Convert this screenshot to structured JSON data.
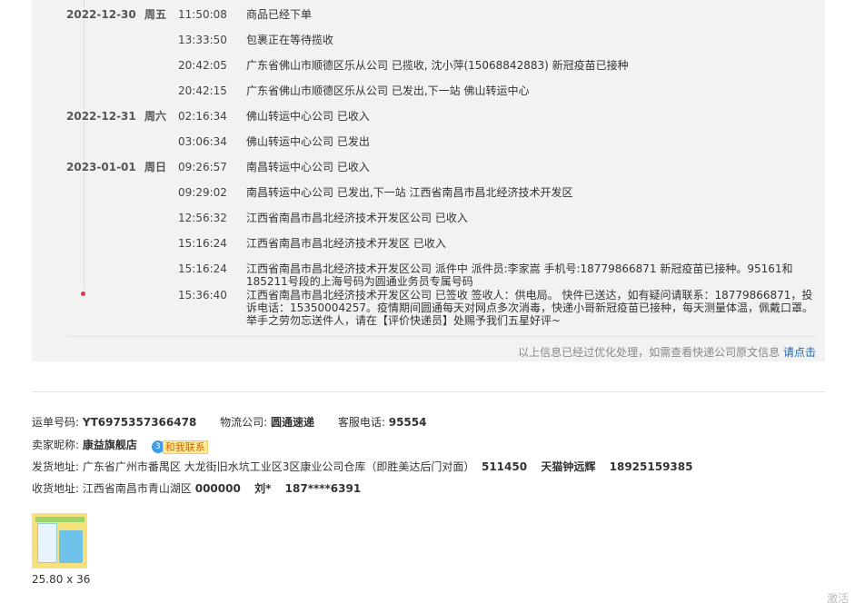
{
  "tracking": [
    {
      "date": "2022-12-30",
      "weekday": "周五",
      "time": "11:50:08",
      "msg": "商品已经下单"
    },
    {
      "date": "",
      "weekday": "",
      "time": "13:33:50",
      "msg": "包裹正在等待揽收"
    },
    {
      "date": "",
      "weekday": "",
      "time": "20:42:05",
      "msg": "广东省佛山市顺德区乐从公司 已揽收, 沈小萍(15068842883) 新冠疫苗已接种"
    },
    {
      "date": "",
      "weekday": "",
      "time": "20:42:15",
      "msg": "广东省佛山市顺德区乐从公司 已发出,下一站 佛山转运中心"
    },
    {
      "date": "2022-12-31",
      "weekday": "周六",
      "time": "02:16:34",
      "msg": "佛山转运中心公司 已收入"
    },
    {
      "date": "",
      "weekday": "",
      "time": "03:06:34",
      "msg": "佛山转运中心公司 已发出"
    },
    {
      "date": "2023-01-01",
      "weekday": "周日",
      "time": "09:26:57",
      "msg": "南昌转运中心公司 已收入"
    },
    {
      "date": "",
      "weekday": "",
      "time": "09:29:02",
      "msg": "南昌转运中心公司 已发出,下一站 江西省南昌市昌北经济技术开发区"
    },
    {
      "date": "",
      "weekday": "",
      "time": "12:56:32",
      "msg": "江西省南昌市昌北经济技术开发区公司 已收入"
    },
    {
      "date": "",
      "weekday": "",
      "time": "15:16:24",
      "msg": "江西省南昌市昌北经济技术开发区 已收入"
    },
    {
      "date": "",
      "weekday": "",
      "time": "15:16:24",
      "msg": "江西省南昌市昌北经济技术开发区公司 派件中 派件员:李家嵩 手机号:18779866871 新冠疫苗已接种。95161和185211号段的上海号码为圆通业务员专属号码"
    },
    {
      "date": "",
      "weekday": "",
      "time": "15:36:40",
      "msg": "江西省南昌市昌北经济技术开发区公司 已签收 签收人：供电局。 快件已送达，如有疑问请联系：18779866871，投诉电话：15350004257。疫情期间圆通每天对网点多次消毒，快递小哥新冠疫苗已接种，每天测量体温，佩戴口罩。举手之劳勿忘送件人，请在【评价快递员】处赐予我们五星好评~"
    }
  ],
  "note": {
    "text": "以上信息已经过优化处理，如需查看快递公司原文信息 ",
    "link": "请点击"
  },
  "info": {
    "waybill_label": "运单号码:",
    "waybill": "YT6975357366478",
    "carrier_label": "物流公司:",
    "carrier": "圆通速递",
    "phone_label": "客服电话:",
    "phone": "95554",
    "seller_label": "卖家昵称:",
    "seller": "康益旗舰店",
    "contact_badge": "3",
    "contact_label": "和我联系",
    "ship_label": "发货地址:",
    "ship_address": "广东省广州市番禺区 大龙街旧水坑工业区3区康业公司仓库（即胜美达后门对面）",
    "ship_zip": "511450",
    "ship_name": "天猫钟远辉",
    "ship_phone": "18925159385",
    "recv_label": "收货地址:",
    "recv_address": "江西省南昌市青山湖区",
    "recv_zip": "000000",
    "recv_name": "刘*",
    "recv_phone": "187****6391"
  },
  "product": {
    "caption": "25.80 x 36"
  },
  "watermark": "激活"
}
